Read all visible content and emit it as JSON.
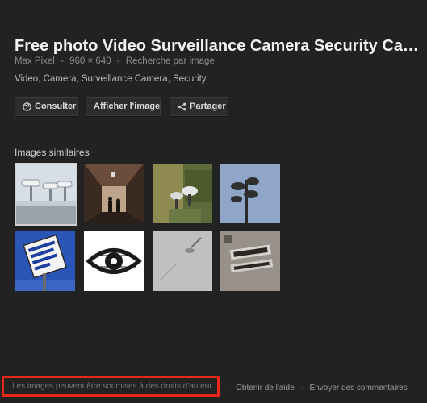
{
  "result": {
    "title": "Free photo Video Surveillance Camera Security Ca…",
    "source": "Max Pixel",
    "dimensions": "960 × 640",
    "search_by_image": "Recherche par image",
    "tags": "Video, Camera, Surveillance Camera, Security"
  },
  "actions": {
    "visit_label": "Consulter",
    "view_image_label": "Afficher l'image",
    "share_label": "Partager"
  },
  "similar": {
    "label": "Images similaires",
    "thumbs": [
      {
        "name": "security-cameras-on-wall",
        "selected": true
      },
      {
        "name": "corridor-people"
      },
      {
        "name": "cameras-on-tree"
      },
      {
        "name": "camera-pole-sky"
      },
      {
        "name": "security-sign-blue"
      },
      {
        "name": "eye-drawing"
      },
      {
        "name": "grey-wall-camera"
      },
      {
        "name": "graffiti-wall"
      }
    ]
  },
  "footer": {
    "copyright_notice": "Les images peuvent être soumises à des droits d'auteur.",
    "help_link": "Obtenir de l'aide",
    "feedback_link": "Envoyer des commentaires",
    "separator": "-"
  },
  "colors": {
    "background": "#222222",
    "highlight_box": "#e8261a"
  }
}
